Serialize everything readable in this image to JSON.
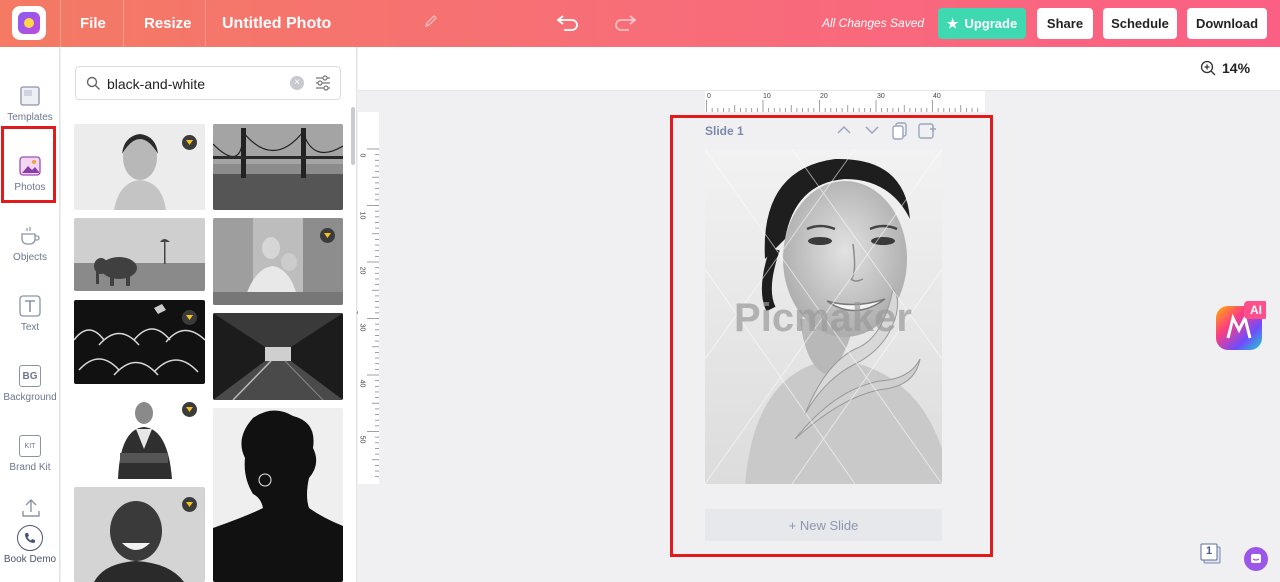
{
  "topbar": {
    "file_label": "File",
    "resize_label": "Resize",
    "title": "Untitled Photo",
    "saved_status": "All Changes Saved",
    "upgrade_label": "Upgrade",
    "share_label": "Share",
    "schedule_label": "Schedule",
    "download_label": "Download",
    "colors": {
      "gradient_start": "#f47a63",
      "gradient_end": "#fc5f84",
      "upgrade": "#3ed8b1"
    },
    "icons": [
      "app-logo-icon",
      "pencil-icon",
      "undo-icon",
      "redo-icon",
      "star-icon"
    ]
  },
  "sidebar": {
    "items": [
      {
        "label": "Templates",
        "icon": "templates-icon"
      },
      {
        "label": "Photos",
        "icon": "photos-icon",
        "active": true
      },
      {
        "label": "Objects",
        "icon": "objects-icon"
      },
      {
        "label": "Text",
        "icon": "text-icon"
      },
      {
        "label": "Background",
        "icon": "background-icon",
        "icon_text": "BG"
      },
      {
        "label": "Brand Kit",
        "icon": "brand-kit-icon",
        "icon_text": "KIT"
      },
      {
        "label": "Book Demo",
        "icon": "phone-icon"
      }
    ]
  },
  "photos_panel": {
    "search_value": "black-and-white",
    "icons": [
      "search-icon",
      "clear-icon",
      "filter-icon"
    ],
    "thumbnails": [
      {
        "subject": "smiling woman portrait",
        "premium": true
      },
      {
        "subject": "golden gate bridge",
        "premium": false
      },
      {
        "subject": "elephant on savanna",
        "premium": false
      },
      {
        "subject": "laughing woman on rooftop",
        "premium": true
      },
      {
        "subject": "sheep backs close-up",
        "premium": true
      },
      {
        "subject": "tunnel interior",
        "premium": false
      },
      {
        "subject": "older man arms crossed",
        "premium": true
      },
      {
        "subject": "silhouette man with curly hair",
        "premium": false
      },
      {
        "subject": "laughing man",
        "premium": true
      }
    ]
  },
  "canvas": {
    "zoom": "14%",
    "ruler_h_ticks": [
      "0",
      "10",
      "20",
      "30",
      "40"
    ],
    "ruler_v_ticks": [
      "0",
      "10",
      "20",
      "30",
      "40",
      "50"
    ],
    "slide_title": "Slide 1",
    "watermark": "Picmaker",
    "new_slide_label": "+ New Slide",
    "ai_label": "AI",
    "page_count": "1"
  }
}
